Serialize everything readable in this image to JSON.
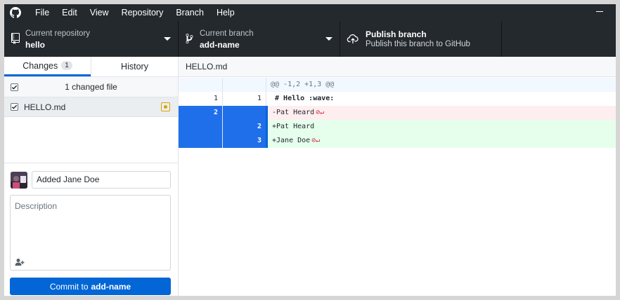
{
  "menu": {
    "items": [
      "File",
      "Edit",
      "View",
      "Repository",
      "Branch",
      "Help"
    ]
  },
  "toolbar": {
    "repo_label": "Current repository",
    "repo_value": "hello",
    "branch_label": "Current branch",
    "branch_value": "add-name",
    "publish_title": "Publish branch",
    "publish_sub": "Publish this branch to GitHub"
  },
  "sidebar": {
    "tabs": [
      {
        "label": "Changes",
        "count": "1"
      },
      {
        "label": "History"
      }
    ],
    "changed_header": "1 changed file",
    "files": [
      {
        "name": "HELLO.md",
        "status": "modified"
      }
    ]
  },
  "commit": {
    "summary_value": "Added Jane Doe",
    "description_placeholder": "Description",
    "button_prefix": "Commit to",
    "button_branch": "add-name"
  },
  "diff": {
    "file_name": "HELLO.md",
    "rows": [
      {
        "type": "hunk",
        "old": "",
        "new": "",
        "text": "@@ -1,2 +1,3 @@"
      },
      {
        "type": "context",
        "old": "1",
        "new": "1",
        "text": " # Hello :wave:"
      },
      {
        "type": "deleted",
        "old": "2",
        "new": "",
        "text": "-Pat Heard"
      },
      {
        "type": "added",
        "old": "",
        "new": "2",
        "text": "+Pat Heard"
      },
      {
        "type": "added",
        "old": "",
        "new": "3",
        "text": "+Jane Doe"
      }
    ]
  },
  "colors": {
    "toolbar_bg": "#24292e",
    "accent_blue": "#0366d6",
    "deleted_bg": "#ffeef0",
    "added_bg": "#e6ffed",
    "modified_badge": "#d9a400"
  }
}
